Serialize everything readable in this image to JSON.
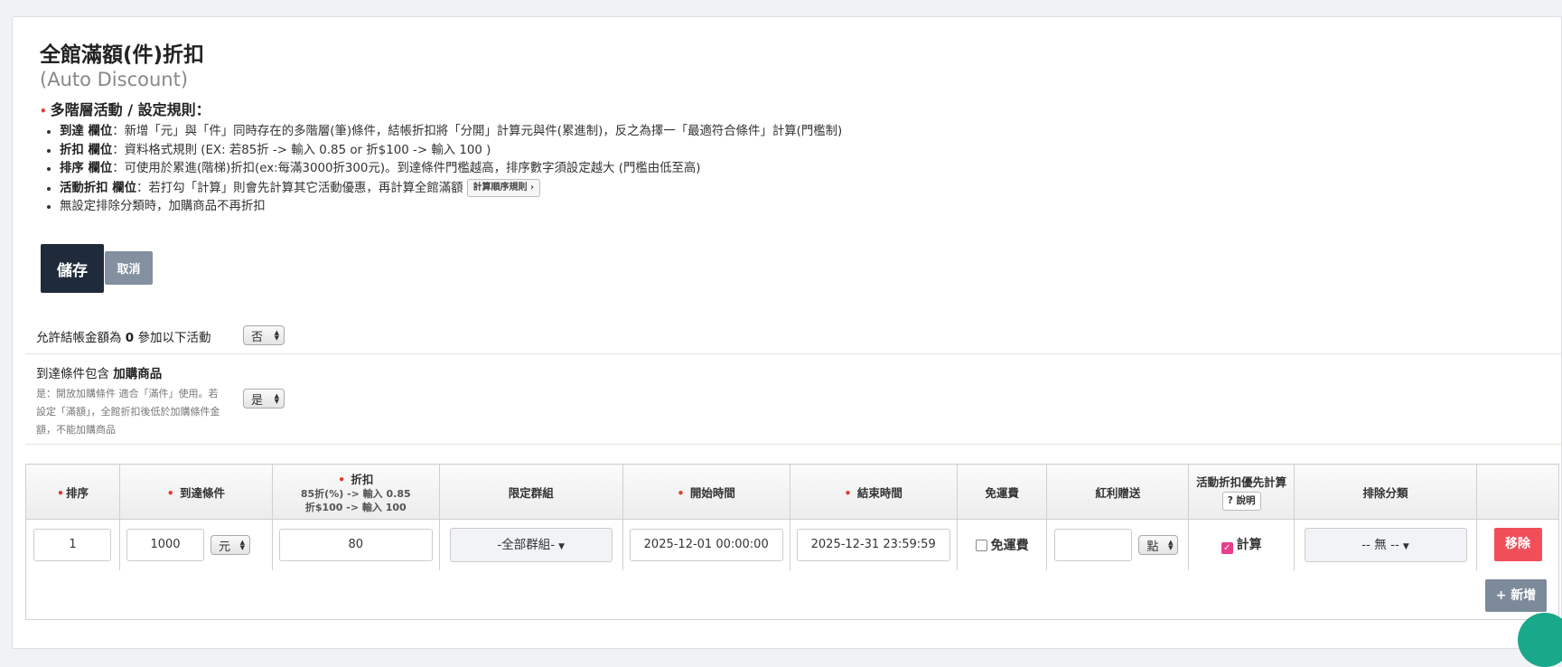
{
  "page": {
    "title": "全館滿額(件)折扣",
    "subtitle": "(Auto Discount)"
  },
  "rules": {
    "heading": "多階層活動 / 設定規則：",
    "items": [
      {
        "label": "到達 欄位",
        "text": "：新增「元」與「件」同時存在的多階層(筆)條件，結帳折扣將「分開」計算元與件(累進制)，反之為擇一「最適符合條件」計算(門檻制)"
      },
      {
        "label": "折扣 欄位",
        "text": "：資料格式規則 (EX: 若85折 -> 輸入 0.85 or 折$100 -> 輸入 100 )"
      },
      {
        "label": "排序 欄位",
        "text": "：可使用於累進(階梯)折扣(ex:每滿3000折300元)。到達條件門檻越高，排序數字須設定越大 (門檻由低至高)"
      },
      {
        "label": "活動折扣 欄位",
        "text": "：若打勾「計算」則會先計算其它活動優惠，再計算全館滿額"
      },
      {
        "label": "",
        "text": "無設定排除分類時，加購商品不再折扣"
      }
    ],
    "calc_order_button": "計算順序規則 ›"
  },
  "actions": {
    "save": "儲存",
    "cancel": "取消"
  },
  "settings": {
    "zero_amount": {
      "label_pre": "允許結帳金額為 ",
      "label_bold": "0",
      "label_post": " 參加以下活動",
      "value": "否"
    },
    "addon": {
      "label_pre": "到達條件包含 ",
      "label_bold": "加購商品",
      "note": "是：開放加購條件 適合「滿件」使用。若設定「滿額」，全館折扣後低於加購條件金額，不能加購商品",
      "value": "是"
    }
  },
  "table": {
    "headers": {
      "order": "排序",
      "condition": "到達條件",
      "discount": "折扣",
      "discount_hint1": "85折(%) -> 輸入 0.85",
      "discount_hint2": "折$100 -> 輸入 100",
      "group": "限定群組",
      "start": "開始時間",
      "end": "結束時間",
      "free_shipping": "免運費",
      "bonus": "紅利贈送",
      "priority": "活動折扣優先計算",
      "priority_help": "? 說明",
      "exclude": "排除分類"
    },
    "row": {
      "order": "1",
      "condition_value": "1000",
      "condition_unit": "元",
      "discount": "80",
      "group": "-全部群組-",
      "start": "2025-12-01 00:00:00",
      "end": "2025-12-31 23:59:59",
      "free_shipping_label": "免運費",
      "free_shipping_checked": false,
      "bonus_value": "",
      "bonus_unit": "點",
      "priority_label": "計算",
      "priority_checked": true,
      "exclude": "-- 無 --",
      "remove": "移除"
    },
    "add_button": "+ 新增"
  }
}
